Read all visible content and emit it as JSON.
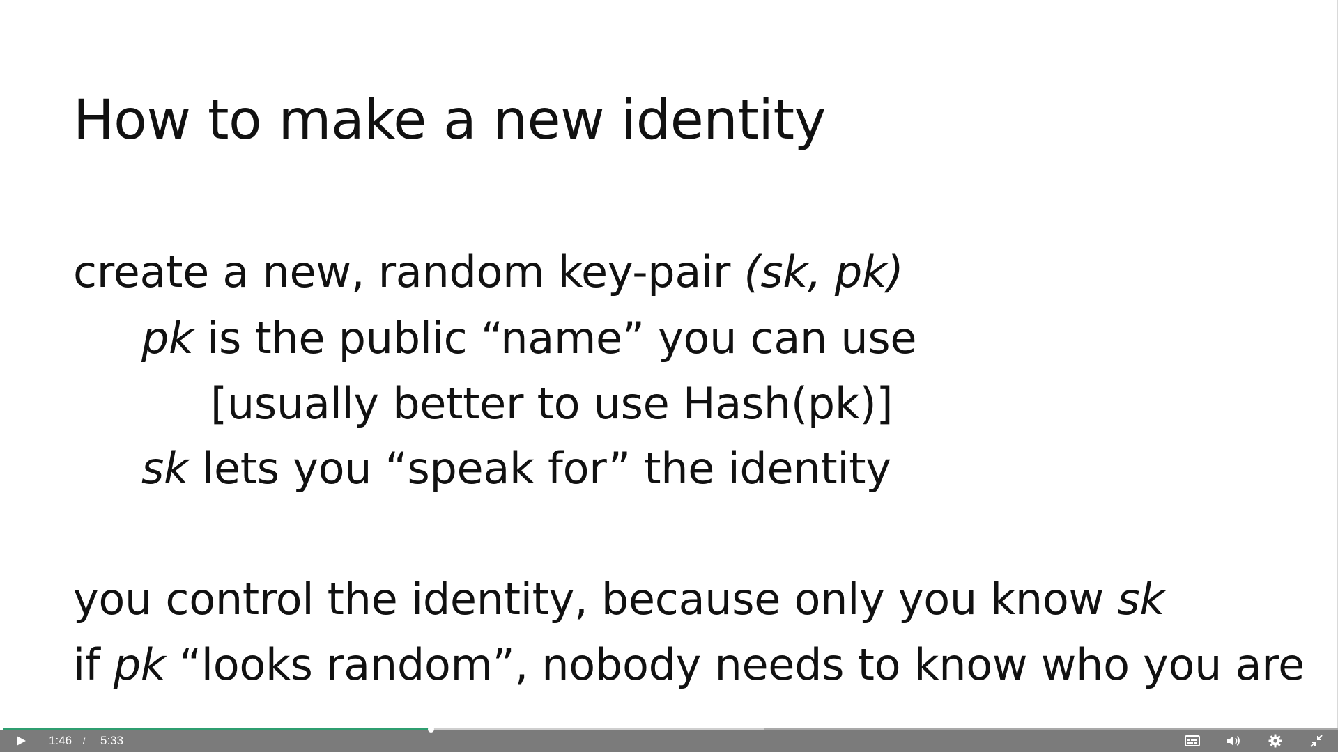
{
  "slide": {
    "title": "How to make a new identity",
    "line1": {
      "text": "create a new, random key-pair ",
      "em": "(sk, pk)"
    },
    "line2": {
      "em": "pk",
      "text": " is the public “name” you can use"
    },
    "line3": {
      "text": "[usually better to use Hash(pk)]"
    },
    "line4": {
      "em": "sk",
      "text": " lets you “speak for” the identity"
    },
    "line5": {
      "text": "you control the identity, because only you know ",
      "em": "sk"
    },
    "line6": {
      "pre": "if ",
      "em": "pk",
      "text": " “looks random”, nobody needs to know who you are"
    }
  },
  "player": {
    "current_time": "1:46",
    "separator": "/",
    "duration": "5:33",
    "played_fraction": 0.32,
    "buffered_fraction": 0.57,
    "icons": {
      "play": "play-icon",
      "captions": "captions-icon",
      "volume": "volume-icon",
      "settings": "gear-icon",
      "exit_fullscreen": "exit-fullscreen-icon"
    },
    "colors": {
      "played": "#2f9e70",
      "bar": "#7b7b7b"
    }
  }
}
